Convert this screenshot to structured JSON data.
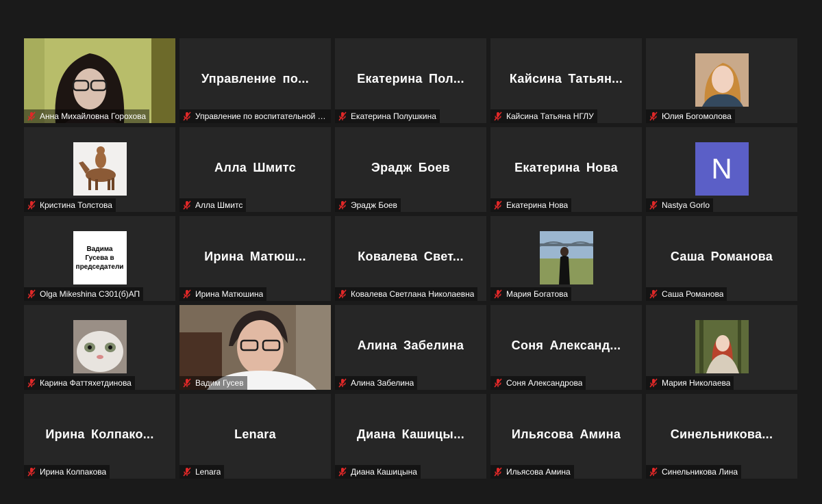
{
  "participants": [
    {
      "name": "Анна Михайловна Горохова",
      "display": "",
      "kind": "video"
    },
    {
      "name": "Управление по воспитательной р...",
      "display": "Управление по...",
      "kind": "name"
    },
    {
      "name": "Екатерина Полушкина",
      "display": "Екатерина Пол...",
      "kind": "name"
    },
    {
      "name": "Кайсина Татьяна НГЛУ",
      "display": "Кайсина Татьян...",
      "kind": "name"
    },
    {
      "name": "Юлия Богомолова",
      "display": "",
      "kind": "avatar",
      "avatar": "woman-portrait"
    },
    {
      "name": "Кристина Толстова",
      "display": "",
      "kind": "avatar",
      "avatar": "horse-rider"
    },
    {
      "name": "Алла Шмитс",
      "display": "Алла Шмитс",
      "kind": "name"
    },
    {
      "name": "Эрадж Боев",
      "display": "Эрадж Боев",
      "kind": "name"
    },
    {
      "name": "Екатерина Нова",
      "display": "Екатерина Нова",
      "kind": "name"
    },
    {
      "name": "Nastya Gorlo",
      "display": "",
      "kind": "letter",
      "letter": "N"
    },
    {
      "name": "Olga Mikeshina С301(б)АП",
      "display": "",
      "kind": "sign",
      "sign_text": "Вадима Гусева в председатели"
    },
    {
      "name": "Ирина Матюшина",
      "display": "Ирина Матюш...",
      "kind": "name"
    },
    {
      "name": "Ковалева Светлана Николаевна",
      "display": "Ковалева Свет...",
      "kind": "name"
    },
    {
      "name": "Мария Богатова",
      "display": "",
      "kind": "avatar",
      "avatar": "bridge-photo"
    },
    {
      "name": "Саша Романова",
      "display": "Саша Романова",
      "kind": "name"
    },
    {
      "name": "Карина Фаттяхетдинова",
      "display": "",
      "kind": "avatar",
      "avatar": "cat"
    },
    {
      "name": "Вадим Гусев",
      "display": "",
      "kind": "video",
      "speaking": true
    },
    {
      "name": "Алина Забелина",
      "display": "Алина Забелина",
      "kind": "name"
    },
    {
      "name": "Соня Александрова",
      "display": "Соня Александ...",
      "kind": "name"
    },
    {
      "name": "Мария Николаева",
      "display": "",
      "kind": "avatar",
      "avatar": "woman-forest"
    },
    {
      "name": "Ирина Колпакова",
      "display": "Ирина Колпако...",
      "kind": "name"
    },
    {
      "name": "Lenara",
      "display": "Lenara",
      "kind": "name"
    },
    {
      "name": "Диана Кашицына",
      "display": "Диана Кашицы...",
      "kind": "name"
    },
    {
      "name": "Ильясова Амина",
      "display": "Ильясова Амина",
      "kind": "name"
    },
    {
      "name": "Синельникова Лина",
      "display": "Синельникова...",
      "kind": "name"
    }
  ],
  "colors": {
    "background": "#1a1a1a",
    "tile": "#262626",
    "speaker_border": "#c9f07a",
    "letter_avatar": "#5b5fc7",
    "muted_icon": "#e02828"
  },
  "icons": {
    "muted": "mic-muted-icon"
  }
}
